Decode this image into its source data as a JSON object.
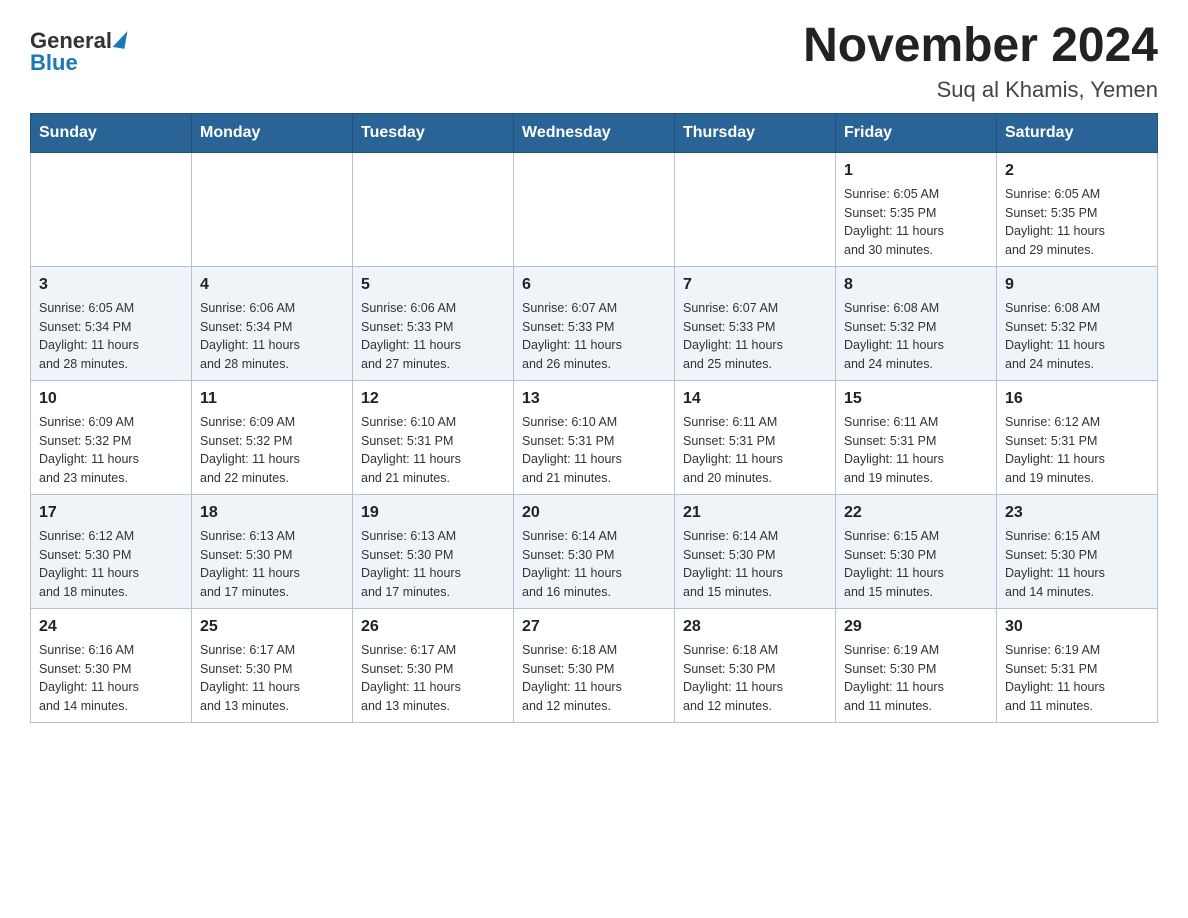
{
  "header": {
    "logo_general": "General",
    "logo_blue": "Blue",
    "month_year": "November 2024",
    "location": "Suq al Khamis, Yemen"
  },
  "weekdays": [
    "Sunday",
    "Monday",
    "Tuesday",
    "Wednesday",
    "Thursday",
    "Friday",
    "Saturday"
  ],
  "weeks": [
    [
      {
        "day": "",
        "info": ""
      },
      {
        "day": "",
        "info": ""
      },
      {
        "day": "",
        "info": ""
      },
      {
        "day": "",
        "info": ""
      },
      {
        "day": "",
        "info": ""
      },
      {
        "day": "1",
        "info": "Sunrise: 6:05 AM\nSunset: 5:35 PM\nDaylight: 11 hours\nand 30 minutes."
      },
      {
        "day": "2",
        "info": "Sunrise: 6:05 AM\nSunset: 5:35 PM\nDaylight: 11 hours\nand 29 minutes."
      }
    ],
    [
      {
        "day": "3",
        "info": "Sunrise: 6:05 AM\nSunset: 5:34 PM\nDaylight: 11 hours\nand 28 minutes."
      },
      {
        "day": "4",
        "info": "Sunrise: 6:06 AM\nSunset: 5:34 PM\nDaylight: 11 hours\nand 28 minutes."
      },
      {
        "day": "5",
        "info": "Sunrise: 6:06 AM\nSunset: 5:33 PM\nDaylight: 11 hours\nand 27 minutes."
      },
      {
        "day": "6",
        "info": "Sunrise: 6:07 AM\nSunset: 5:33 PM\nDaylight: 11 hours\nand 26 minutes."
      },
      {
        "day": "7",
        "info": "Sunrise: 6:07 AM\nSunset: 5:33 PM\nDaylight: 11 hours\nand 25 minutes."
      },
      {
        "day": "8",
        "info": "Sunrise: 6:08 AM\nSunset: 5:32 PM\nDaylight: 11 hours\nand 24 minutes."
      },
      {
        "day": "9",
        "info": "Sunrise: 6:08 AM\nSunset: 5:32 PM\nDaylight: 11 hours\nand 24 minutes."
      }
    ],
    [
      {
        "day": "10",
        "info": "Sunrise: 6:09 AM\nSunset: 5:32 PM\nDaylight: 11 hours\nand 23 minutes."
      },
      {
        "day": "11",
        "info": "Sunrise: 6:09 AM\nSunset: 5:32 PM\nDaylight: 11 hours\nand 22 minutes."
      },
      {
        "day": "12",
        "info": "Sunrise: 6:10 AM\nSunset: 5:31 PM\nDaylight: 11 hours\nand 21 minutes."
      },
      {
        "day": "13",
        "info": "Sunrise: 6:10 AM\nSunset: 5:31 PM\nDaylight: 11 hours\nand 21 minutes."
      },
      {
        "day": "14",
        "info": "Sunrise: 6:11 AM\nSunset: 5:31 PM\nDaylight: 11 hours\nand 20 minutes."
      },
      {
        "day": "15",
        "info": "Sunrise: 6:11 AM\nSunset: 5:31 PM\nDaylight: 11 hours\nand 19 minutes."
      },
      {
        "day": "16",
        "info": "Sunrise: 6:12 AM\nSunset: 5:31 PM\nDaylight: 11 hours\nand 19 minutes."
      }
    ],
    [
      {
        "day": "17",
        "info": "Sunrise: 6:12 AM\nSunset: 5:30 PM\nDaylight: 11 hours\nand 18 minutes."
      },
      {
        "day": "18",
        "info": "Sunrise: 6:13 AM\nSunset: 5:30 PM\nDaylight: 11 hours\nand 17 minutes."
      },
      {
        "day": "19",
        "info": "Sunrise: 6:13 AM\nSunset: 5:30 PM\nDaylight: 11 hours\nand 17 minutes."
      },
      {
        "day": "20",
        "info": "Sunrise: 6:14 AM\nSunset: 5:30 PM\nDaylight: 11 hours\nand 16 minutes."
      },
      {
        "day": "21",
        "info": "Sunrise: 6:14 AM\nSunset: 5:30 PM\nDaylight: 11 hours\nand 15 minutes."
      },
      {
        "day": "22",
        "info": "Sunrise: 6:15 AM\nSunset: 5:30 PM\nDaylight: 11 hours\nand 15 minutes."
      },
      {
        "day": "23",
        "info": "Sunrise: 6:15 AM\nSunset: 5:30 PM\nDaylight: 11 hours\nand 14 minutes."
      }
    ],
    [
      {
        "day": "24",
        "info": "Sunrise: 6:16 AM\nSunset: 5:30 PM\nDaylight: 11 hours\nand 14 minutes."
      },
      {
        "day": "25",
        "info": "Sunrise: 6:17 AM\nSunset: 5:30 PM\nDaylight: 11 hours\nand 13 minutes."
      },
      {
        "day": "26",
        "info": "Sunrise: 6:17 AM\nSunset: 5:30 PM\nDaylight: 11 hours\nand 13 minutes."
      },
      {
        "day": "27",
        "info": "Sunrise: 6:18 AM\nSunset: 5:30 PM\nDaylight: 11 hours\nand 12 minutes."
      },
      {
        "day": "28",
        "info": "Sunrise: 6:18 AM\nSunset: 5:30 PM\nDaylight: 11 hours\nand 12 minutes."
      },
      {
        "day": "29",
        "info": "Sunrise: 6:19 AM\nSunset: 5:30 PM\nDaylight: 11 hours\nand 11 minutes."
      },
      {
        "day": "30",
        "info": "Sunrise: 6:19 AM\nSunset: 5:31 PM\nDaylight: 11 hours\nand 11 minutes."
      }
    ]
  ]
}
